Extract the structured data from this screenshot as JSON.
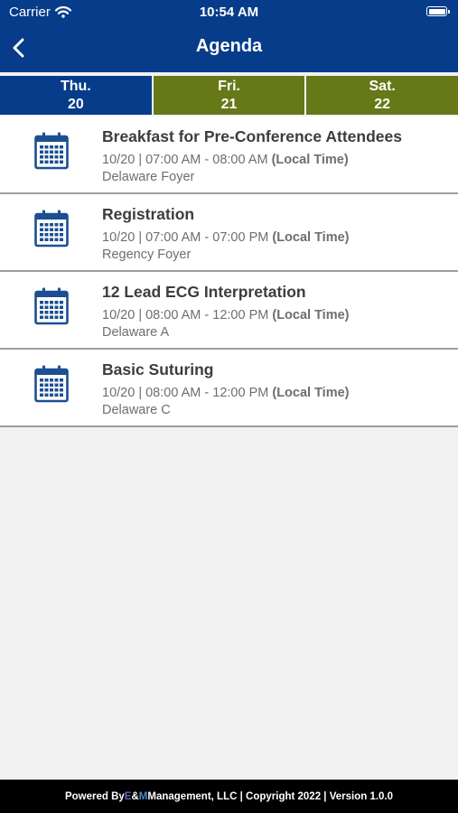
{
  "status_bar": {
    "carrier": "Carrier",
    "time": "10:54 AM"
  },
  "nav": {
    "title": "Agenda"
  },
  "day_tabs": [
    {
      "day": "Thu.",
      "date": "20"
    },
    {
      "day": "Fri.",
      "date": "21"
    },
    {
      "day": "Sat.",
      "date": "22"
    }
  ],
  "agenda": [
    {
      "title": "Breakfast for Pre-Conference Attendees",
      "time": "10/20 | 07:00 AM - 08:00 AM ",
      "tz": "(Local Time)",
      "location": "Delaware Foyer"
    },
    {
      "title": "Registration",
      "time": "10/20 | 07:00 AM - 07:00 PM ",
      "tz": "(Local Time)",
      "location": "Regency Foyer"
    },
    {
      "title": "12 Lead ECG Interpretation",
      "time": "10/20 | 08:00 AM - 12:00 PM ",
      "tz": "(Local Time)",
      "location": "Delaware A"
    },
    {
      "title": "Basic Suturing",
      "time": "10/20 | 08:00 AM - 12:00 PM ",
      "tz": "(Local Time)",
      "location": "Delaware C"
    }
  ],
  "footer": {
    "prefix": "Powered By ",
    "brand_e": "E",
    "brand_amp": "&",
    "brand_m": "M",
    "suffix": " Management, LLC | Copyright 2022 | Version 1.0.0"
  },
  "colors": {
    "header": "#063c8a",
    "inactive_tab": "#667818",
    "footer": "#000000"
  }
}
